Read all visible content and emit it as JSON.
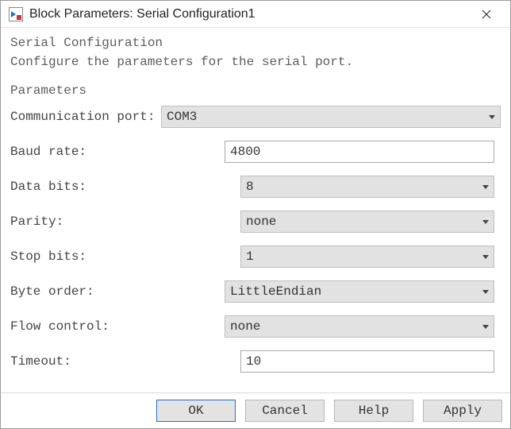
{
  "window": {
    "title": "Block Parameters: Serial Configuration1"
  },
  "header": {
    "section": "Serial Configuration",
    "description": "Configure the parameters for the serial port."
  },
  "parameters": {
    "section": "Parameters",
    "communication_port": {
      "label": "Communication port:",
      "value": "COM3"
    },
    "baud_rate": {
      "label": "Baud rate:",
      "value": "4800"
    },
    "data_bits": {
      "label": "Data bits:",
      "value": "8"
    },
    "parity": {
      "label": "Parity:",
      "value": "none"
    },
    "stop_bits": {
      "label": "Stop bits:",
      "value": "1"
    },
    "byte_order": {
      "label": "Byte order:",
      "value": "LittleEndian"
    },
    "flow_control": {
      "label": "Flow control:",
      "value": "none"
    },
    "timeout": {
      "label": "Timeout:",
      "value": "10"
    }
  },
  "buttons": {
    "ok": "OK",
    "cancel": "Cancel",
    "help": "Help",
    "apply": "Apply"
  }
}
